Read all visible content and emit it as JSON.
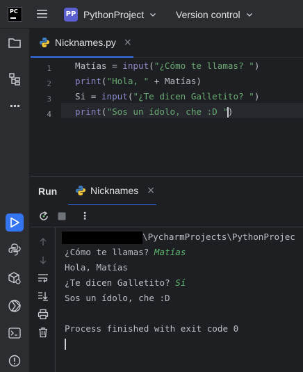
{
  "titlebar": {
    "logo_text": "PC",
    "project_badge": "PP",
    "project_name": "PythonProject",
    "vcs_label": "Version control"
  },
  "toolstrip": {
    "icons": [
      "folder-icon",
      "structure-icon",
      "more-icon",
      "run-icon",
      "python-console-icon",
      "python-packages-icon",
      "services-icon",
      "terminal-icon",
      "problems-icon"
    ],
    "more_glyph": "···"
  },
  "editor": {
    "tab_label": "Nicknames.py",
    "tab_close": "×",
    "line_numbers": [
      "1",
      "2",
      "3",
      "4"
    ],
    "lines": [
      {
        "a": "Matías",
        "b": " = ",
        "c": "input",
        "d": "(",
        "e": "\"¿Cómo te llamas? \"",
        "f": ")"
      },
      {
        "a": "print",
        "b": "(",
        "c": "\"Hola, \"",
        "d": " + Matías)"
      },
      {
        "a": "Si",
        "b": " = ",
        "c": "input",
        "d": "(",
        "e": "\"¿Te dicen Galletito? \"",
        "f": ")"
      },
      {
        "a": "print",
        "b": "(",
        "c": "\"Sos un ídolo, che :D \"",
        "d": ")"
      }
    ]
  },
  "run_panel": {
    "title": "Run",
    "tab_label": "Nicknames",
    "tab_close": "×",
    "more_glyph": "⋮",
    "console": {
      "path_suffix": "\\PycharmProjects\\PythonProjec",
      "line1_prompt": "¿Cómo te llamas? ",
      "line1_input": "Matías",
      "line2": "Hola, Matías",
      "line3_prompt": "¿Te dicen Galletito? ",
      "line3_input": "Sí",
      "line4": "Sos un ídolo, che :D",
      "exit_line": "Process finished with exit code 0"
    }
  },
  "colors": {
    "accent": "#3574f0",
    "string": "#6aab73",
    "builtin": "#8888c6",
    "user_input": "#5fb870"
  }
}
